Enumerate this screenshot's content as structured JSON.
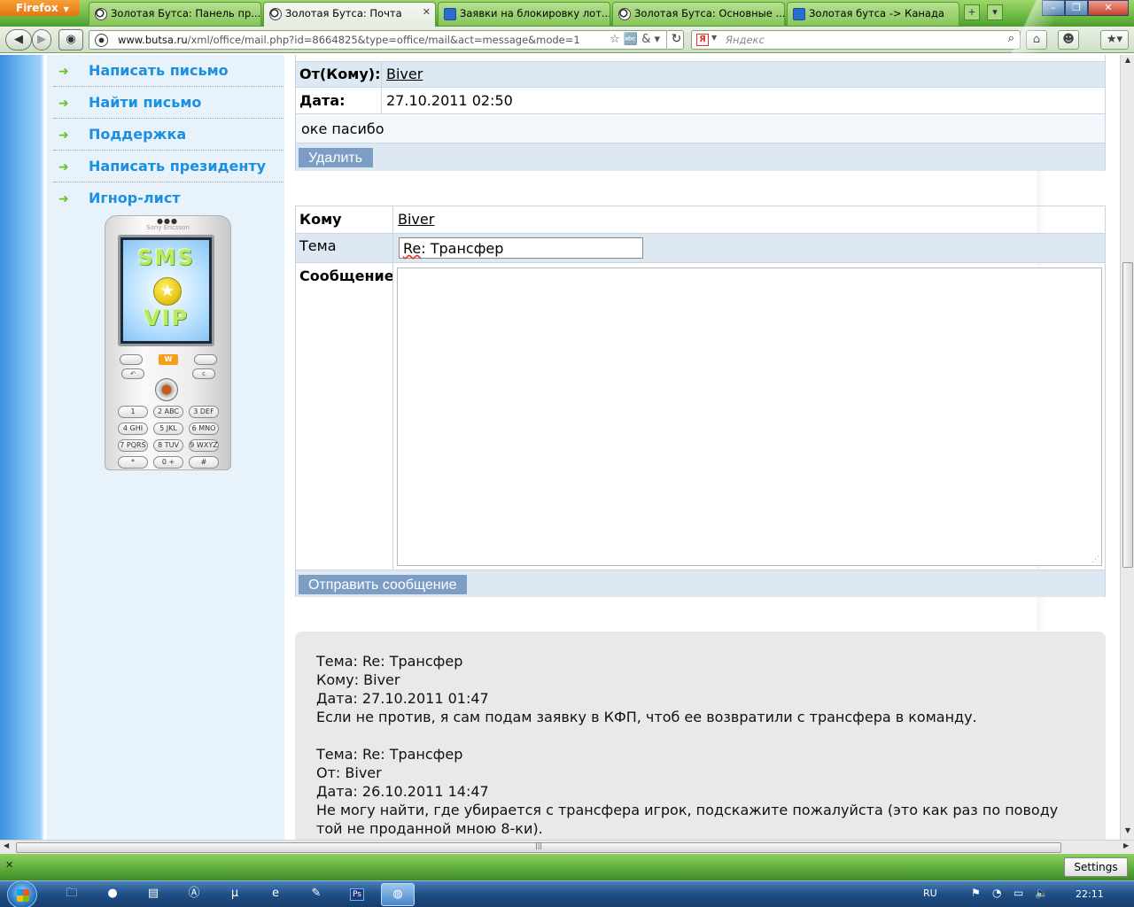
{
  "browser": {
    "menu_label": "Firefox",
    "tabs": [
      {
        "title": "Золотая Бутса: Панель пр...",
        "active": false,
        "icon": "ball-icon"
      },
      {
        "title": "Золотая Бутса: Почта",
        "active": true,
        "icon": "ball-icon"
      },
      {
        "title": "Заявки на блокировку лот...",
        "active": false,
        "icon": "calendar-icon"
      },
      {
        "title": "Золотая Бутса: Основные ...",
        "active": false,
        "icon": "ball-icon"
      },
      {
        "title": "Золотая бутса -> Канада",
        "active": false,
        "icon": "calendar-icon"
      }
    ],
    "url_host": "www.butsa.ru",
    "url_path": "/xml/office/mail.php?id=8664825&type=office/mail&act=message&mode=1",
    "search_placeholder": "Яндекс",
    "search_engine_letter": "Я"
  },
  "sidebar": {
    "items": [
      {
        "label": "Написать письмо"
      },
      {
        "label": "Найти письмо"
      },
      {
        "label": "Поддержка"
      },
      {
        "label": "Написать президенту"
      },
      {
        "label": "Игнор-лист"
      }
    ],
    "ad": {
      "brand": "Sony Ericsson",
      "line1": "SMS",
      "line2": "VIP",
      "walkman": "W",
      "keys": [
        "1",
        "2 ABC",
        "3 DEF",
        "4 GHI",
        "5 JKL",
        "6 MNO",
        "7 PQRS",
        "8 TUV",
        "9 WXYZ",
        "*",
        "0 +",
        "#"
      ]
    }
  },
  "message": {
    "from_label": "От(Кому):",
    "from_value": "Biver",
    "date_label": "Дата:",
    "date_value": "27.10.2011 02:50",
    "body": "оке пасибо",
    "delete_button": "Удалить"
  },
  "reply_form": {
    "to_label": "Кому",
    "to_value": "Biver",
    "subject_label": "Тема",
    "subject_prefix": "Re",
    "subject_rest": ": Трансфер",
    "message_label": "Сообщение",
    "message_value": "",
    "send_button": "Отправить сообщение"
  },
  "history": [
    {
      "subject": "Тема: Re: Трансфер",
      "party": "Кому: Biver",
      "date": "Дата: 27.10.2011 01:47",
      "text": "Если не против, я сам подам заявку в КФП, чтоб ее возвратили с трансфера в команду."
    },
    {
      "subject": "Тема: Re: Трансфер",
      "party": "От: Biver",
      "date": "Дата: 26.10.2011 14:47",
      "text": "Не могу найти, где убирается с трансфера игрок, подскажите пожалуйста (это как раз по поводу той не проданной мною 8-ки)."
    }
  ],
  "addon_bar": {
    "settings_label": "Settings"
  },
  "taskbar": {
    "apps": [
      "explorer-icon",
      "media-icon",
      "disk-icon",
      "aim-icon",
      "utorrent-icon",
      "ie-icon",
      "folder-icon",
      "photoshop-icon",
      "firefox-icon"
    ],
    "language": "RU",
    "clock": "22:11",
    "photoshop_label": "Ps"
  }
}
